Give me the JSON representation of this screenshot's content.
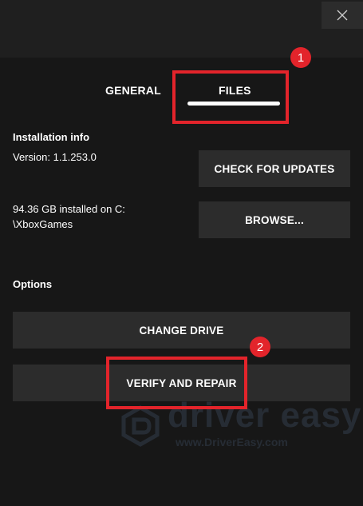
{
  "tabs": [
    {
      "label": "GENERAL",
      "active": false
    },
    {
      "label": "FILES",
      "active": true
    }
  ],
  "installation": {
    "title": "Installation info",
    "version": "Version: 1.1.253.0",
    "size_line1": "94.36 GB installed on C:",
    "size_line2": "\\XboxGames",
    "check_updates_label": "CHECK FOR UPDATES",
    "browse_label": "BROWSE..."
  },
  "options": {
    "title": "Options",
    "change_drive_label": "CHANGE DRIVE",
    "verify_repair_label": "VERIFY AND REPAIR"
  },
  "annotations": {
    "step1": "1",
    "step2": "2",
    "highlight_color": "#e3242b"
  },
  "watermark": {
    "brand": "driver easy",
    "url": "www.DriverEasy.com"
  },
  "icons": {
    "close": "close-icon",
    "logo": "driver-easy-logo-icon"
  }
}
